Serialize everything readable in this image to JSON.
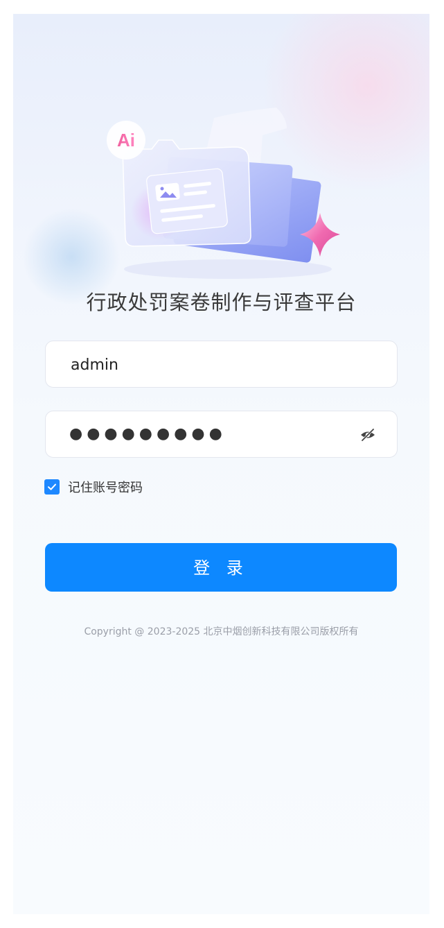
{
  "app": {
    "title": "行政处罚案卷制作与评查平台",
    "logo_text": "Ai"
  },
  "form": {
    "username_value": "admin",
    "password_mask": "●●●●●●●●●",
    "toggle_visibility_icon": "eye-off-icon",
    "remember_label": "记住账号密码",
    "remember_checked": true,
    "login_label": "登 录"
  },
  "footer": {
    "copyright": "Copyright @ 2023-2025 北京中烟创新科技有限公司版权所有"
  },
  "colors": {
    "primary": "#0d88ff",
    "checkbox": "#1e88ff",
    "title_text": "#3a3a3a"
  }
}
